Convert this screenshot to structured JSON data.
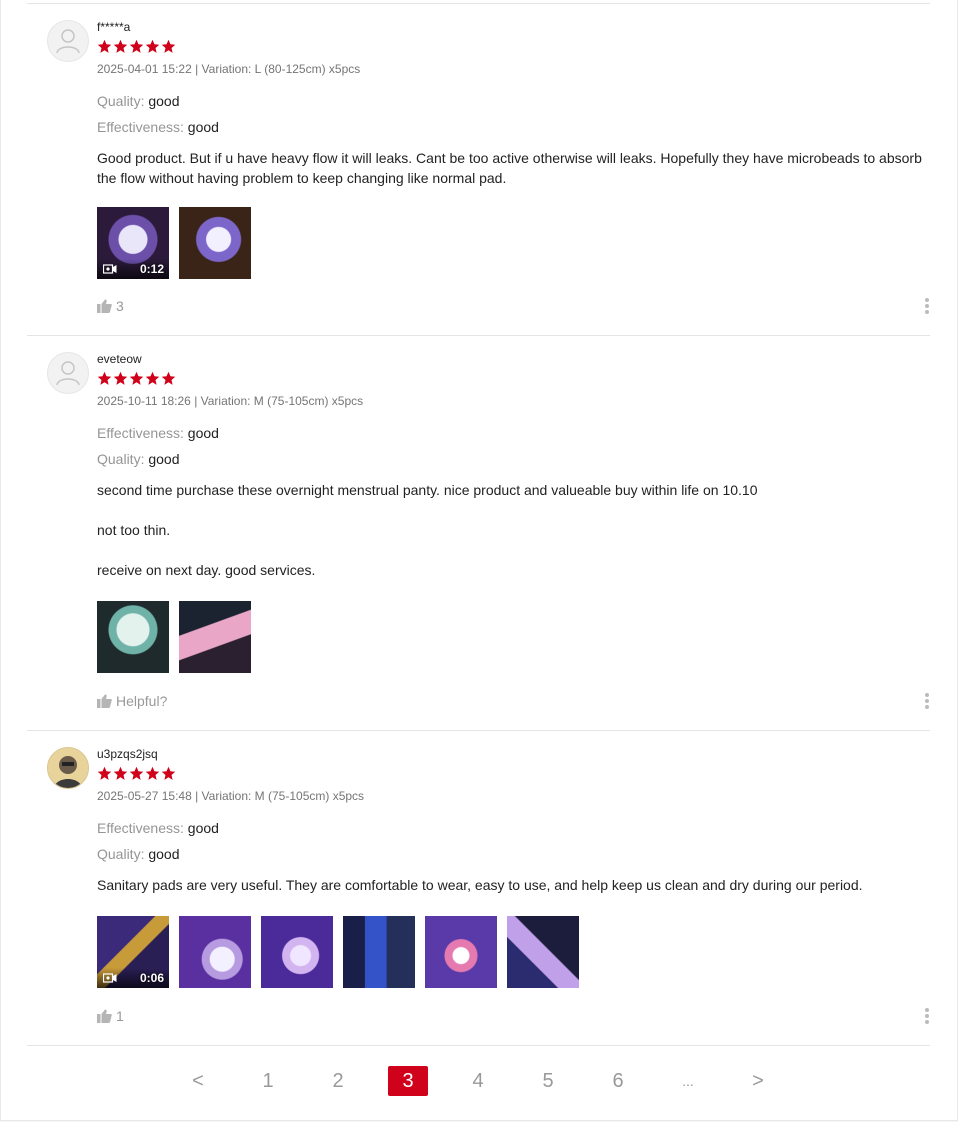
{
  "reviews": [
    {
      "username": "f*****a",
      "rating": 5,
      "meta": "2025-04-01 15:22 | Variation: L (80-125cm) x5pcs",
      "attributes": [
        {
          "label": "Quality:",
          "value": "good"
        },
        {
          "label": "Effectiveness:",
          "value": "good"
        }
      ],
      "paragraphs": [
        "Good product. But if u have heavy flow it will leaks. Cant be too active otherwise will leaks. Hopefully they have microbeads to absorb the flow without having problem to keep changing like normal pad."
      ],
      "media": [
        {
          "type": "video",
          "duration": "0:12"
        },
        {
          "type": "image"
        }
      ],
      "likes": "3"
    },
    {
      "username": "eveteow",
      "rating": 5,
      "meta": "2025-10-11 18:26 | Variation: M (75-105cm) x5pcs",
      "attributes": [
        {
          "label": "Effectiveness:",
          "value": "good"
        },
        {
          "label": "Quality:",
          "value": "good"
        }
      ],
      "paragraphs": [
        "second time purchase these overnight menstrual panty. nice product and valueable buy within life on 10.10",
        "not too thin.",
        "receive on next day. good services."
      ],
      "media": [
        {
          "type": "image"
        },
        {
          "type": "image"
        }
      ],
      "likes": "Helpful?"
    },
    {
      "username": "u3pzqs2jsq",
      "rating": 5,
      "meta": "2025-05-27 15:48 | Variation: M (75-105cm) x5pcs",
      "attributes": [
        {
          "label": "Effectiveness:",
          "value": "good"
        },
        {
          "label": "Quality:",
          "value": "good"
        }
      ],
      "paragraphs": [
        "Sanitary pads are very useful. They are comfortable to wear, easy to use, and help keep us clean and dry during our period."
      ],
      "media": [
        {
          "type": "video",
          "duration": "0:06"
        },
        {
          "type": "image"
        },
        {
          "type": "image"
        },
        {
          "type": "image"
        },
        {
          "type": "image"
        },
        {
          "type": "image"
        }
      ],
      "likes": "1"
    }
  ],
  "pagination": {
    "prev": "<",
    "pages": [
      "1",
      "2",
      "3",
      "4",
      "5",
      "6"
    ],
    "current": "3",
    "ellipsis": "...",
    "next": ">"
  },
  "colors": {
    "accent": "#d0011b",
    "star": "#d0011b",
    "muted": "#999999"
  },
  "icons": {
    "avatar_placeholder": "user-silhouette-icon",
    "like": "thumbs-up-icon",
    "more": "vertical-dots-icon",
    "video": "video-camera-icon",
    "star": "star-icon"
  }
}
